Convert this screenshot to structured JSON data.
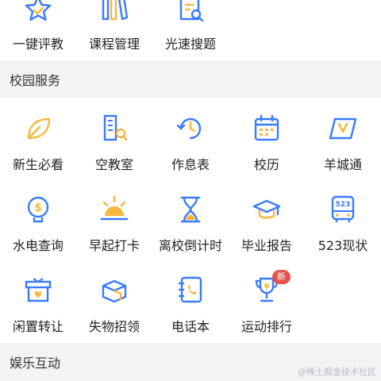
{
  "top_row": [
    {
      "label": "一键评教",
      "icon": "star-icon"
    },
    {
      "label": "课程管理",
      "icon": "books-icon"
    },
    {
      "label": "光速搜题",
      "icon": "document-search-icon"
    }
  ],
  "campus_section": {
    "title": "校园服务"
  },
  "campus_rows": [
    [
      {
        "label": "新生必看",
        "icon": "leaf-icon"
      },
      {
        "label": "空教室",
        "icon": "building-search-icon"
      },
      {
        "label": "作息表",
        "icon": "clock-arrow-icon"
      },
      {
        "label": "校历",
        "icon": "calendar-icon"
      },
      {
        "label": "羊城通",
        "icon": "card-icon"
      }
    ],
    [
      {
        "label": "水电查询",
        "icon": "bulb-dollar-icon"
      },
      {
        "label": "早起打卡",
        "icon": "sunrise-icon"
      },
      {
        "label": "离校倒计时",
        "icon": "hourglass-icon"
      },
      {
        "label": "毕业报告",
        "icon": "graduation-cap-icon"
      },
      {
        "label": "523现状",
        "icon": "bus-icon",
        "icon_text": "523"
      }
    ],
    [
      {
        "label": "闲置转让",
        "icon": "box-heart-icon"
      },
      {
        "label": "失物招领",
        "icon": "open-box-icon"
      },
      {
        "label": "电话本",
        "icon": "phone-book-icon"
      },
      {
        "label": "运动排行",
        "icon": "trophy-icon",
        "badge": "新"
      }
    ]
  ],
  "entertainment_section": {
    "title": "娱乐互动"
  },
  "watermark": "@稀土掘金技术社区",
  "colors": {
    "blue": "#3a7afe",
    "yellow": "#f5b83b",
    "section_bg": "#f2f3f5",
    "badge": "#e5534b"
  }
}
